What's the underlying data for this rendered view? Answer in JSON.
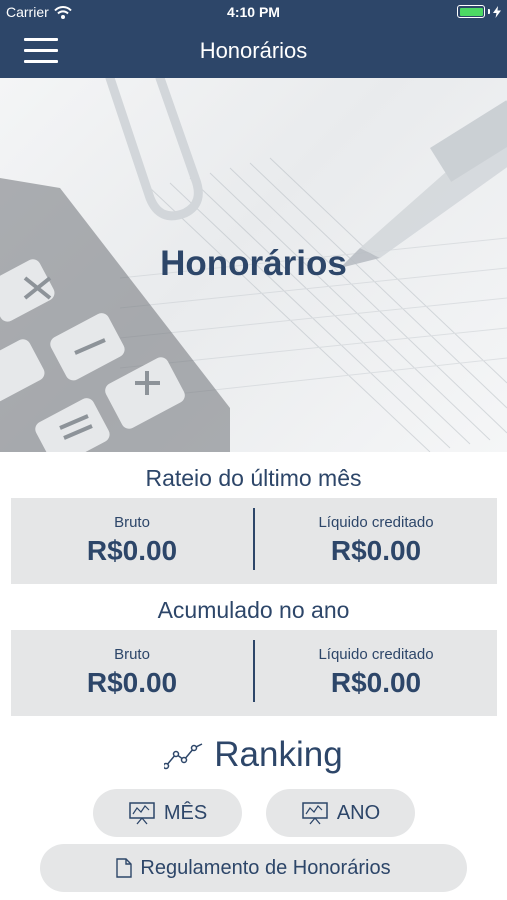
{
  "status_bar": {
    "carrier": "Carrier",
    "time": "4:10 PM",
    "battery_level": 1.0,
    "battery_color": "#4cd964"
  },
  "nav": {
    "title": "Honorários",
    "menu_icon": "hamburger-menu-icon",
    "background": "#2d4669"
  },
  "hero": {
    "title": "Honorários"
  },
  "last_month": {
    "title": "Rateio do último mês",
    "gross_label": "Bruto",
    "gross_value": "R$0.00",
    "net_label": "Líquido creditado",
    "net_value": "R$0.00"
  },
  "year_to_date": {
    "title": "Acumulado no ano",
    "gross_label": "Bruto",
    "gross_value": "R$0.00",
    "net_label": "Líquido creditado",
    "net_value": "R$0.00"
  },
  "ranking": {
    "title": "Ranking",
    "icon": "line-chart-icon",
    "month_button": "MÊS",
    "year_button": "ANO",
    "button_icon": "presentation-chart-icon"
  },
  "regulation_button": {
    "label": "Regulamento de Honorários",
    "icon": "document-icon"
  }
}
